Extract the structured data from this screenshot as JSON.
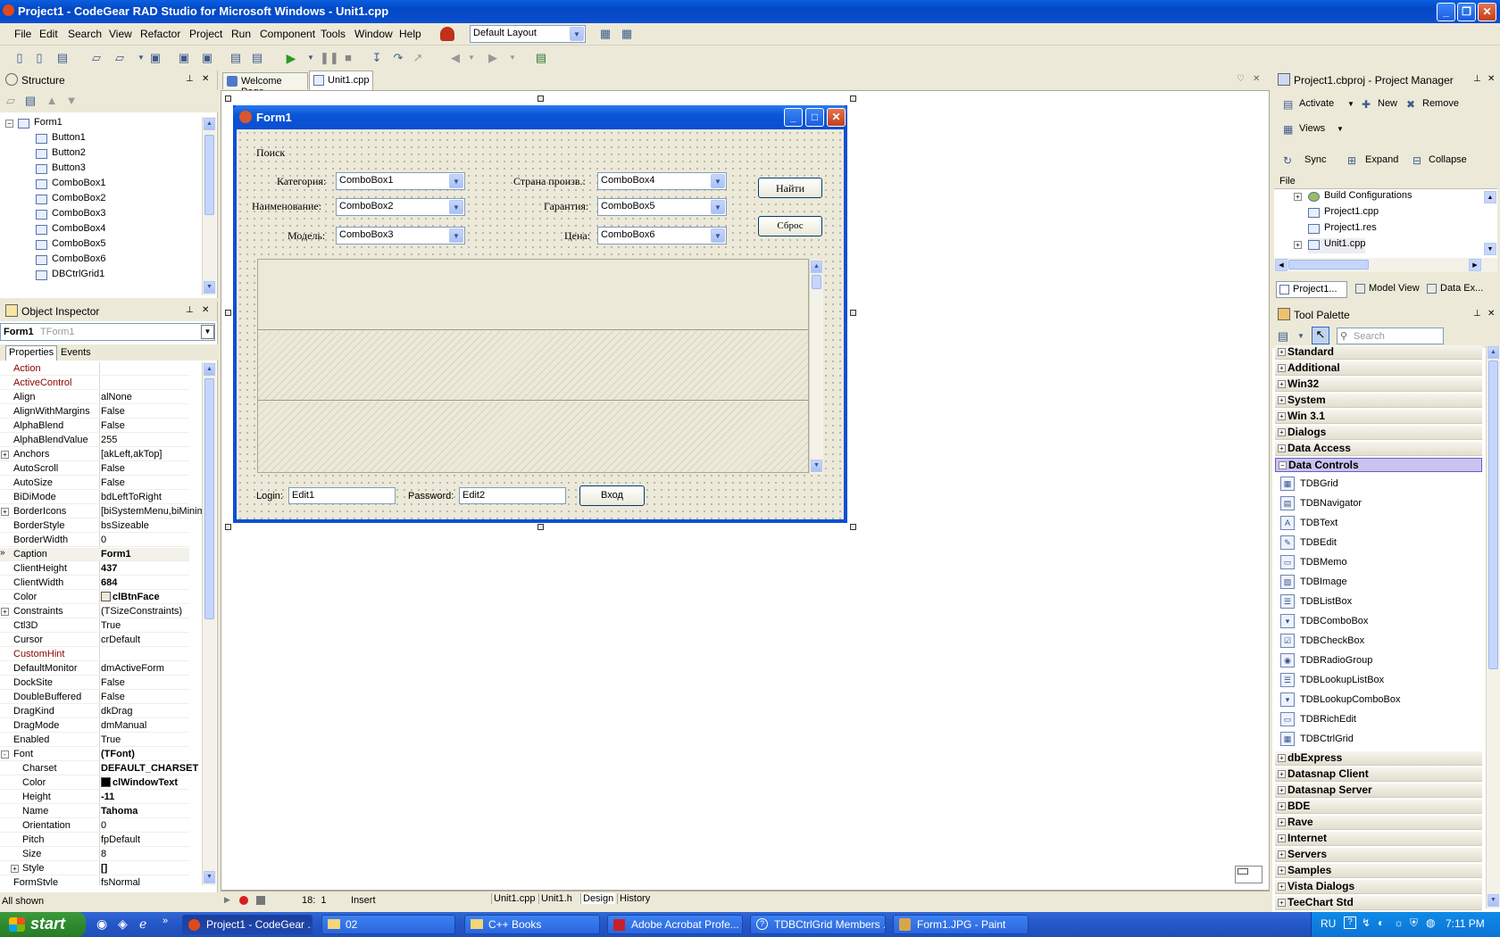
{
  "window": {
    "title": "Project1 - CodeGear RAD Studio for Microsoft Windows - Unit1.cpp"
  },
  "menu": [
    "File",
    "Edit",
    "Search",
    "View",
    "Refactor",
    "Project",
    "Run",
    "Component",
    "Tools",
    "Window",
    "Help"
  ],
  "layout_combo": "Default Layout",
  "structure": {
    "title": "Structure",
    "root": "Form1",
    "items": [
      "Button1",
      "Button2",
      "Button3",
      "ComboBox1",
      "ComboBox2",
      "ComboBox3",
      "ComboBox4",
      "ComboBox5",
      "ComboBox6",
      "DBCtrlGrid1"
    ]
  },
  "object_inspector": {
    "title": "Object Inspector",
    "selected_name": "Form1",
    "selected_type": "TForm1",
    "tabs": [
      "Properties",
      "Events"
    ],
    "properties": [
      {
        "name": "Action",
        "value": "",
        "style": "red"
      },
      {
        "name": "ActiveControl",
        "value": "",
        "style": "red"
      },
      {
        "name": "Align",
        "value": "alNone"
      },
      {
        "name": "AlignWithMargins",
        "value": "False"
      },
      {
        "name": "AlphaBlend",
        "value": "False"
      },
      {
        "name": "AlphaBlendValue",
        "value": "255"
      },
      {
        "name": "Anchors",
        "value": "[akLeft,akTop]",
        "expand": "+"
      },
      {
        "name": "AutoScroll",
        "value": "False"
      },
      {
        "name": "AutoSize",
        "value": "False"
      },
      {
        "name": "BiDiMode",
        "value": "bdLeftToRight"
      },
      {
        "name": "BorderIcons",
        "value": "[biSystemMenu,biMinim",
        "expand": "+"
      },
      {
        "name": "BorderStyle",
        "value": "bsSizeable"
      },
      {
        "name": "BorderWidth",
        "value": "0"
      },
      {
        "name": "Caption",
        "value": "Form1",
        "bold": true,
        "selected": true
      },
      {
        "name": "ClientHeight",
        "value": "437",
        "bold": true
      },
      {
        "name": "ClientWidth",
        "value": "684",
        "bold": true
      },
      {
        "name": "Color",
        "value": "clBtnFace",
        "bold": true,
        "swatch": "#ece9d8"
      },
      {
        "name": "Constraints",
        "value": "(TSizeConstraints)",
        "expand": "+"
      },
      {
        "name": "Ctl3D",
        "value": "True"
      },
      {
        "name": "Cursor",
        "value": "crDefault"
      },
      {
        "name": "CustomHint",
        "value": "",
        "style": "red"
      },
      {
        "name": "DefaultMonitor",
        "value": "dmActiveForm"
      },
      {
        "name": "DockSite",
        "value": "False"
      },
      {
        "name": "DoubleBuffered",
        "value": "False"
      },
      {
        "name": "DragKind",
        "value": "dkDrag"
      },
      {
        "name": "DragMode",
        "value": "dmManual"
      },
      {
        "name": "Enabled",
        "value": "True"
      },
      {
        "name": "Font",
        "value": "(TFont)",
        "expand": "-",
        "bold": true
      },
      {
        "name": "Charset",
        "value": "DEFAULT_CHARSET",
        "bold": true,
        "indent": true
      },
      {
        "name": "Color",
        "value": "clWindowText",
        "bold": true,
        "indent": true,
        "swatch": "#000000"
      },
      {
        "name": "Height",
        "value": "-11",
        "bold": true,
        "indent": true
      },
      {
        "name": "Name",
        "value": "Tahoma",
        "bold": true,
        "indent": true
      },
      {
        "name": "Orientation",
        "value": "0",
        "indent": true
      },
      {
        "name": "Pitch",
        "value": "fpDefault",
        "indent": true
      },
      {
        "name": "Size",
        "value": "8",
        "indent": true
      },
      {
        "name": "Style",
        "value": "[]",
        "bold": true,
        "indent": true,
        "expand": "+"
      },
      {
        "name": "FormStyle",
        "value": "fsNormal"
      }
    ],
    "status": "All shown"
  },
  "editor": {
    "tabs": [
      "Welcome Page",
      "Unit1.cpp"
    ],
    "bottom_tabs": [
      "Unit1.cpp",
      "Unit1.h",
      "Design",
      "History"
    ],
    "position": "18:  1",
    "mode": "Insert"
  },
  "form": {
    "title": "Form1",
    "search_label": "Поиск",
    "labels": {
      "category": "Категория:",
      "name": "Наименование:",
      "model": "Модель:",
      "country": "Страна произв.:",
      "warranty": "Гарантия:",
      "price": "Цена:"
    },
    "combos": [
      "ComboBox1",
      "ComboBox2",
      "ComboBox3",
      "ComboBox4",
      "ComboBox5",
      "ComboBox6"
    ],
    "find_button": "Найти",
    "reset_button": "Сброс",
    "login_label": "Login:",
    "login_value": "Edit1",
    "password_label": "Password:",
    "password_value": "Edit2",
    "enter_button": "Вход"
  },
  "project_manager": {
    "title": "Project1.cbproj - Project Manager",
    "buttons": [
      "Activate",
      "New",
      "Remove",
      "Views",
      "Sync",
      "Expand",
      "Collapse"
    ],
    "column": "File",
    "tree": [
      "Build Configurations",
      "Project1.cpp",
      "Project1.res",
      "Unit1.cpp"
    ],
    "tabs": [
      "Project1...",
      "Model View",
      "Data Ex..."
    ]
  },
  "tool_palette": {
    "title": "Tool Palette",
    "search_placeholder": "Search",
    "categories_top": [
      "Standard",
      "Additional",
      "Win32",
      "System",
      "Win 3.1",
      "Dialogs",
      "Data Access"
    ],
    "open_category": "Data Controls",
    "items": [
      "TDBGrid",
      "TDBNavigator",
      "TDBText",
      "TDBEdit",
      "TDBMemo",
      "TDBImage",
      "TDBListBox",
      "TDBComboBox",
      "TDBCheckBox",
      "TDBRadioGroup",
      "TDBLookupListBox",
      "TDBLookupComboBox",
      "TDBRichEdit",
      "TDBCtrlGrid"
    ],
    "categories_bottom": [
      "dbExpress",
      "Datasnap Client",
      "Datasnap Server",
      "BDE",
      "Rave",
      "Internet",
      "Servers",
      "Samples",
      "Vista Dialogs",
      "TeeChart Std"
    ]
  },
  "taskbar": {
    "start": "start",
    "tasks": [
      "Project1 - CodeGear ...",
      "02",
      "C++ Books",
      "Adobe Acrobat Profe...",
      "TDBCtrlGrid Members ...",
      "Form1.JPG - Paint"
    ],
    "lang": "RU",
    "time": "7:11 PM"
  }
}
